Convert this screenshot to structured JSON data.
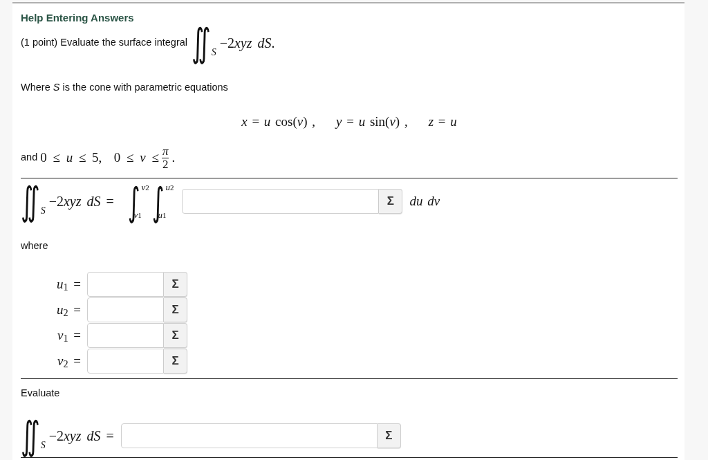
{
  "heading": {
    "title": "Help Entering Answers"
  },
  "problem": {
    "intro": "(1 point) Evaluate the surface integral",
    "integral": {
      "sign": "∬",
      "domain": "S",
      "coefficient": "−2",
      "expression": "xyz dS",
      "tail": "."
    },
    "surface_text": "Where *S* is the cone with parametric equations",
    "equations": [
      "*x* = *u* cos(*v*) ,",
      "*y* = *u* sin(*v*) ,",
      "*z* = *u*"
    ],
    "bounds": {
      "lead": "and",
      "math": "0 ≤ *u* ≤ 5,  0 ≤ *v* ≤",
      "fraction": {
        "numerator": "π",
        "denominator": "2"
      },
      "trail": "."
    }
  },
  "setup": {
    "lhs": {
      "sign": "∬",
      "domain": "S",
      "coefficient": "−2",
      "expression": "xyz dS",
      "relation": "="
    },
    "integrals": [
      {
        "sign": "∫",
        "upper": {
          "variable": "v",
          "index": "2"
        },
        "lower": {
          "variable": "v",
          "index": "1"
        }
      },
      {
        "sign": "∫",
        "upper": {
          "variable": "u",
          "index": "2"
        },
        "lower": {
          "variable": "u",
          "index": "1"
        }
      }
    ],
    "button": "Σ",
    "differentials": "du dv"
  },
  "where": {
    "label": "where",
    "limits": [
      {
        "variable": "*u*$_{1}$ =",
        "button": "Σ"
      },
      {
        "variable": "*u*$_{2}$ =",
        "button": "Σ"
      },
      {
        "variable": "*v*$_{1}$ =",
        "button": "Σ"
      },
      {
        "variable": "*v*$_{2}$ =",
        "button": "Σ"
      }
    ]
  },
  "evaluate": {
    "label": "Evaluate",
    "lhs": {
      "sign": "∬",
      "domain": "S",
      "coefficient": "−2",
      "expression": "xyz dS",
      "relation": "="
    },
    "button": "Σ"
  }
}
